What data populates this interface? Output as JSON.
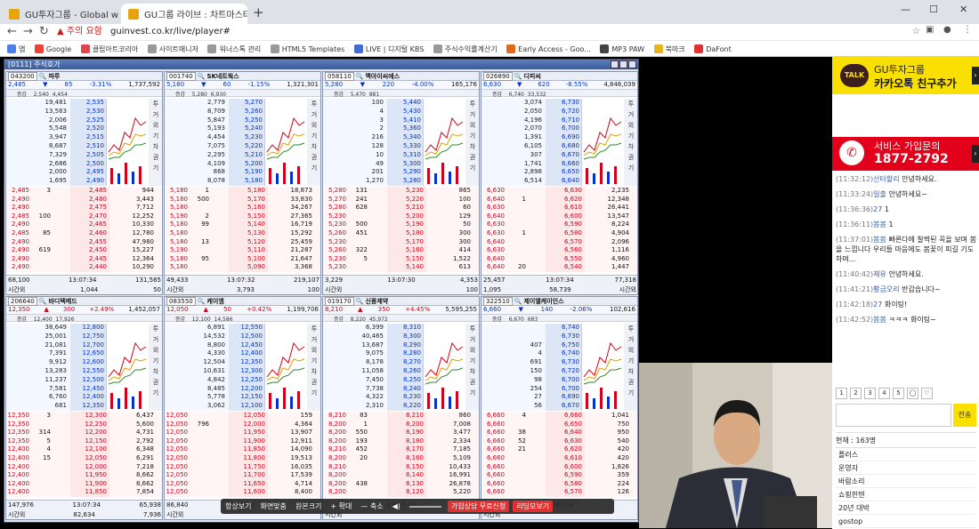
{
  "browser": {
    "tabs": [
      {
        "title": "GU투자그룹 - Global with U",
        "active": false
      },
      {
        "title": "GU그룹 라이브 : 차트마스터",
        "active": true
      }
    ],
    "security_label": "주의 요함",
    "url": "guinvest.co.kr/live/player#",
    "bookmarks": [
      "앱",
      "Google",
      "클립아트코리아",
      "사이트매니저",
      "워너스톡 관리",
      "HTML5 Templates",
      "LIVE | 디지털 KBS",
      "주식수익률계산기",
      "Early Access - Goo...",
      "MP3 PAW",
      "북마크",
      "DaFont"
    ]
  },
  "hts": {
    "window_title": "[0111] 주식호가",
    "panels": [
      {
        "code": "043200",
        "name": "파루",
        "price": "2,485",
        "dir": "down",
        "change": "85",
        "pct": "-3.31%",
        "volume": "1,737,592",
        "amount": "4,454",
        "ask_top": "2,540",
        "asks": [
          [
            "19,481",
            "2,535"
          ],
          [
            "13,563",
            "2,530"
          ],
          [
            "2,006",
            "2,525"
          ],
          [
            "5,548",
            "2,520"
          ],
          [
            "3,947",
            "2,515"
          ],
          [
            "8,687",
            "2,510"
          ],
          [
            "7,329",
            "2,505"
          ],
          [
            "2,686",
            "2,500"
          ],
          [
            "2,000",
            "2,495"
          ],
          [
            "1,695",
            "2,490"
          ]
        ],
        "bids": [
          [
            "2,485",
            "3",
            "2,485",
            "944"
          ],
          [
            "2,490",
            "",
            "2,480",
            "3,443"
          ],
          [
            "2,490",
            "",
            "2,475",
            "7,712"
          ],
          [
            "2,485",
            "100",
            "2,470",
            "12,252"
          ],
          [
            "2,490",
            "",
            "2,465",
            "10,330"
          ],
          [
            "2,485",
            "85",
            "2,460",
            "12,780"
          ],
          [
            "2,490",
            "",
            "2,455",
            "47,980"
          ],
          [
            "2,490",
            "619",
            "2,450",
            "15,227"
          ],
          [
            "2,490",
            "",
            "2,445",
            "12,364"
          ],
          [
            "2,490",
            "",
            "2,440",
            "10,290"
          ]
        ],
        "foot1": [
          "68,100",
          "13:07:34",
          "131,565"
        ],
        "foot2": [
          "시간외",
          "1,044",
          "50"
        ]
      },
      {
        "code": "001740",
        "name": "SK네트웍스",
        "price": "5,180",
        "dir": "down",
        "change": "60",
        "pct": "-1.15%",
        "volume": "1,321,301",
        "amount": "6,930",
        "ask_top": "5,280",
        "asks": [
          [
            "2,779",
            "5,270"
          ],
          [
            "8,709",
            "5,260"
          ],
          [
            "5,847",
            "5,250"
          ],
          [
            "5,193",
            "5,240"
          ],
          [
            "4,454",
            "5,230"
          ],
          [
            "7,075",
            "5,220"
          ],
          [
            "2,295",
            "5,210"
          ],
          [
            "4,109",
            "5,200"
          ],
          [
            "868",
            "5,190"
          ],
          [
            "8,078",
            "5,180"
          ]
        ],
        "bids": [
          [
            "5,180",
            "1",
            "5,180",
            "18,873"
          ],
          [
            "5,180",
            "500",
            "5,170",
            "33,830"
          ],
          [
            "5,180",
            "",
            "5,160",
            "34,267"
          ],
          [
            "5,190",
            "2",
            "5,150",
            "27,365"
          ],
          [
            "5,180",
            "99",
            "5,140",
            "16,719"
          ],
          [
            "5,180",
            "",
            "5,130",
            "15,292"
          ],
          [
            "5,180",
            "13",
            "5,120",
            "25,459"
          ],
          [
            "5,190",
            "",
            "5,110",
            "21,287"
          ],
          [
            "5,180",
            "95",
            "5,100",
            "21,647"
          ],
          [
            "5,180",
            "",
            "5,090",
            "3,368"
          ]
        ],
        "foot1": [
          "49,433",
          "13:07:32",
          "219,107"
        ],
        "foot2": [
          "시간외",
          "3,793",
          "100"
        ]
      },
      {
        "code": "058110",
        "name": "멕아이씨에스",
        "price": "5,280",
        "dir": "down",
        "change": "220",
        "pct": "-4.00%",
        "volume": "165,176",
        "amount": "881",
        "ask_top": "5,470",
        "asks": [
          [
            "100",
            "5,440"
          ],
          [
            "4",
            "5,430"
          ],
          [
            "3",
            "5,410"
          ],
          [
            "2",
            "5,360"
          ],
          [
            "216",
            "5,340"
          ],
          [
            "128",
            "5,330"
          ],
          [
            "10",
            "5,310"
          ],
          [
            "49",
            "5,300"
          ],
          [
            "201",
            "5,290"
          ],
          [
            "1,270",
            "5,280"
          ]
        ],
        "bids": [
          [
            "5,280",
            "131",
            "5,230",
            "865"
          ],
          [
            "5,270",
            "241",
            "5,220",
            "100"
          ],
          [
            "5,280",
            "628",
            "5,210",
            "60"
          ],
          [
            "5,230",
            "",
            "5,200",
            "129"
          ],
          [
            "5,230",
            "500",
            "5,190",
            "50"
          ],
          [
            "5,260",
            "451",
            "5,180",
            "300"
          ],
          [
            "5,230",
            "",
            "5,170",
            "300"
          ],
          [
            "5,260",
            "322",
            "5,160",
            "414"
          ],
          [
            "5,230",
            "5",
            "5,150",
            "1,522"
          ],
          [
            "5,230",
            "",
            "5,140",
            "613"
          ]
        ],
        "foot1": [
          "3,229",
          "13:07:30",
          "4,353"
        ],
        "foot2": [
          "시간외",
          "",
          "100"
        ]
      },
      {
        "code": "026890",
        "name": "디피씨",
        "price": "6,630",
        "dir": "down",
        "change": "620",
        "pct": "-8.55%",
        "volume": "4,846,039",
        "amount": "33,532",
        "ask_top": "6,740",
        "asks": [
          [
            "3,074",
            "6,730"
          ],
          [
            "2,050",
            "6,720"
          ],
          [
            "4,196",
            "6,710"
          ],
          [
            "2,070",
            "6,700"
          ],
          [
            "1,391",
            "6,690"
          ],
          [
            "6,105",
            "6,680"
          ],
          [
            "307",
            "6,670"
          ],
          [
            "1,741",
            "6,660"
          ],
          [
            "2,898",
            "6,650"
          ],
          [
            "6,514",
            "6,640"
          ]
        ],
        "bids": [
          [
            "6,630",
            "",
            "6,630",
            "2,235"
          ],
          [
            "6,640",
            "1",
            "6,620",
            "12,348"
          ],
          [
            "6,630",
            "",
            "6,610",
            "26,441"
          ],
          [
            "6,640",
            "",
            "6,600",
            "13,547"
          ],
          [
            "6,630",
            "",
            "6,590",
            "8,224"
          ],
          [
            "6,630",
            "1",
            "6,580",
            "4,904"
          ],
          [
            "6,640",
            "",
            "6,570",
            "2,096"
          ],
          [
            "6,630",
            "",
            "6,560",
            "1,116"
          ],
          [
            "6,640",
            "",
            "6,550",
            "4,960"
          ],
          [
            "6,640",
            "20",
            "6,540",
            "1,447"
          ]
        ],
        "foot1": [
          "25,457",
          "13:07:34",
          "77,318"
        ],
        "foot2": [
          "1,095",
          "58,739",
          "시간외"
        ]
      },
      {
        "code": "206640",
        "name": "바디텍메드",
        "price": "12,350",
        "dir": "up",
        "change": "300",
        "pct": "+2.49%",
        "volume": "1,452,057",
        "amount": "17,926",
        "ask_top": "12,400",
        "asks": [
          [
            "38,649",
            "12,800"
          ],
          [
            "25,001",
            "12,750"
          ],
          [
            "21,081",
            "12,700"
          ],
          [
            "7,391",
            "12,650"
          ],
          [
            "9,912",
            "12,600"
          ],
          [
            "13,283",
            "12,550"
          ],
          [
            "11,237",
            "12,500"
          ],
          [
            "7,581",
            "12,450"
          ],
          [
            "6,760",
            "12,400"
          ],
          [
            "681",
            "12,350"
          ]
        ],
        "bids": [
          [
            "12,350",
            "3",
            "12,300",
            "6,437"
          ],
          [
            "12,350",
            "",
            "12,250",
            "5,600"
          ],
          [
            "12,350",
            "314",
            "12,200",
            "4,731"
          ],
          [
            "12,350",
            "5",
            "12,150",
            "2,792"
          ],
          [
            "12,400",
            "4",
            "12,100",
            "6,348"
          ],
          [
            "12,400",
            "15",
            "12,050",
            "6,291"
          ],
          [
            "12,400",
            "",
            "12,000",
            "7,218"
          ],
          [
            "12,400",
            "",
            "11,950",
            "8,662"
          ],
          [
            "12,400",
            "",
            "11,900",
            "8,662"
          ],
          [
            "12,400",
            "",
            "11,850",
            "7,854"
          ]
        ],
        "foot1": [
          "147,976",
          "13:07:34",
          "65,938"
        ],
        "foot2": [
          "시간외",
          "82,634",
          "7,936"
        ]
      },
      {
        "code": "083550",
        "name": "케이엠",
        "price": "12,050",
        "dir": "up",
        "change": "50",
        "pct": "+0.42%",
        "volume": "1,199,706",
        "amount": "14,586",
        "ask_top": "12,100",
        "asks": [
          [
            "6,891",
            "12,550"
          ],
          [
            "14,532",
            "12,500"
          ],
          [
            "8,800",
            "12,450"
          ],
          [
            "4,330",
            "12,400"
          ],
          [
            "12,504",
            "12,350"
          ],
          [
            "10,631",
            "12,300"
          ],
          [
            "4,842",
            "12,250"
          ],
          [
            "8,485",
            "12,200"
          ],
          [
            "5,778",
            "12,150"
          ],
          [
            "3,062",
            "12,100"
          ]
        ],
        "bids": [
          [
            "12,050",
            "",
            "12,050",
            "159"
          ],
          [
            "12,050",
            "796",
            "12,000",
            "4,364"
          ],
          [
            "12,050",
            "",
            "11,950",
            "13,907"
          ],
          [
            "12,050",
            "",
            "11,900",
            "12,911"
          ],
          [
            "12,050",
            "",
            "11,850",
            "14,090"
          ],
          [
            "12,050",
            "",
            "11,800",
            "19,513"
          ],
          [
            "12,050",
            "",
            "11,750",
            "16,035"
          ],
          [
            "12,050",
            "",
            "11,700",
            "17,539"
          ],
          [
            "12,050",
            "",
            "11,650",
            "4,714"
          ],
          [
            "12,050",
            "",
            "11,600",
            "8,400"
          ]
        ],
        "foot1": [
          "86,840",
          "13:07:32",
          "138,237"
        ],
        "foot2": [
          "시간외",
          "",
          ""
        ]
      },
      {
        "code": "019170",
        "name": "신풍제약",
        "price": "8,210",
        "dir": "up",
        "change": "350",
        "pct": "+4.45%",
        "volume": "5,595,255",
        "amount": "45,972",
        "ask_top": "8,220",
        "asks": [
          [
            "6,399",
            "8,310"
          ],
          [
            "40,465",
            "8,300"
          ],
          [
            "13,687",
            "8,290"
          ],
          [
            "9,075",
            "8,280"
          ],
          [
            "8,178",
            "8,270"
          ],
          [
            "11,058",
            "8,260"
          ],
          [
            "7,450",
            "8,250"
          ],
          [
            "7,738",
            "8,240"
          ],
          [
            "4,322",
            "8,230"
          ],
          [
            "2,310",
            "8,220"
          ]
        ],
        "bids": [
          [
            "8,210",
            "83",
            "8,210",
            "860"
          ],
          [
            "8,200",
            "1",
            "8,200",
            "7,008"
          ],
          [
            "8,200",
            "550",
            "8,190",
            "3,477"
          ],
          [
            "8,200",
            "193",
            "8,180",
            "2,334"
          ],
          [
            "8,210",
            "452",
            "8,170",
            "7,185"
          ],
          [
            "8,200",
            "20",
            "8,160",
            "5,109"
          ],
          [
            "8,210",
            "",
            "8,150",
            "10,433"
          ],
          [
            "8,200",
            "",
            "8,140",
            "16,991"
          ],
          [
            "8,200",
            "438",
            "8,130",
            "26,878"
          ],
          [
            "8,200",
            "",
            "8,120",
            "5,220"
          ]
        ],
        "foot1": [
          "",
          "13:07:34",
          ""
        ],
        "foot2": [
          "시간외",
          "",
          ""
        ]
      },
      {
        "code": "322510",
        "name": "제이엘케이인스",
        "price": "6,660",
        "dir": "down",
        "change": "140",
        "pct": "-2.06%",
        "volume": "102,616",
        "amount": "683",
        "ask_top": "6,670",
        "asks": [
          [
            "",
            "6,740"
          ],
          [
            "",
            "6,730"
          ],
          [
            "407",
            "6,750"
          ],
          [
            "4",
            "6,740"
          ],
          [
            "691",
            "6,730"
          ],
          [
            "150",
            "6,720"
          ],
          [
            "98",
            "6,700"
          ],
          [
            "254",
            "6,700"
          ],
          [
            "27",
            "6,690"
          ],
          [
            "56",
            "6,670"
          ]
        ],
        "bids": [
          [
            "6,660",
            "4",
            "6,660",
            "1,041"
          ],
          [
            "6,660",
            "",
            "6,650",
            "750"
          ],
          [
            "6,660",
            "38",
            "6,640",
            "950"
          ],
          [
            "6,660",
            "52",
            "6,630",
            "540"
          ],
          [
            "6,660",
            "21",
            "6,620",
            "420"
          ],
          [
            "6,660",
            "",
            "6,610",
            "420"
          ],
          [
            "6,660",
            "",
            "6,600",
            "1,826"
          ],
          [
            "6,660",
            "",
            "6,590",
            "359"
          ],
          [
            "6,660",
            "",
            "6,580",
            "224"
          ],
          [
            "6,660",
            "",
            "6,570",
            "126"
          ]
        ],
        "foot1": [
          "",
          "13:07:34",
          ""
        ],
        "foot2": [
          "시간외",
          "",
          ""
        ]
      }
    ],
    "header_labels": [
      "증감",
      "투",
      "거",
      "외",
      "기",
      "차",
      "권",
      "기"
    ]
  },
  "player_controls": {
    "labels": [
      "항상보기",
      "화면맞춤",
      "원본크기",
      "+ 확대",
      "— 축소"
    ],
    "btn_consult": "가입상담 무료신청",
    "btn_replay": "리딩모보기"
  },
  "sidebar": {
    "kakao_small": "GU투자그룹",
    "kakao_big": "카카오톡 친구추가",
    "talk_logo": "TALK",
    "call_small": "서비스 가입문의",
    "call_number": "1877-2792",
    "chat": [
      {
        "time": "(11:32:12)",
        "nick": "산타할리",
        "text": "안녕하세요."
      },
      {
        "time": "(11:33:24)",
        "nick": "일출",
        "text": "안녕하세요~"
      },
      {
        "time": "(11:36:36)",
        "nick": "27",
        "text": "1"
      },
      {
        "time": "(11:36:11)",
        "nick": "봄봄",
        "text": "1"
      },
      {
        "time": "(11:37:01)",
        "nick": "봄봄",
        "text": "빠른다에 찰짝된 꼭을 보며 봄을 느낍니다 우리들 마음에도 봄꽃이 피길 기도하며..."
      },
      {
        "time": "(11:40:42)",
        "nick": "제유",
        "text": "안녕하세요."
      },
      {
        "time": "(11:41:21)",
        "nick": "황금오리",
        "text": "반갑습니다~"
      },
      {
        "time": "(11:42:18)",
        "nick": "27",
        "text": "화이팅!"
      },
      {
        "time": "(11:42:52)",
        "nick": "봄봄",
        "text": "ㅋㅋㅋ 화이팅~"
      }
    ],
    "emoji_tabs": [
      "1",
      "2",
      "3",
      "4",
      "5"
    ],
    "send_label": "전송",
    "users_header": "현재 : 163명",
    "users": [
      "플러스",
      "운영자",
      "바람소리",
      "쇼핑핀텐",
      "20년 대박",
      "gostop"
    ]
  }
}
